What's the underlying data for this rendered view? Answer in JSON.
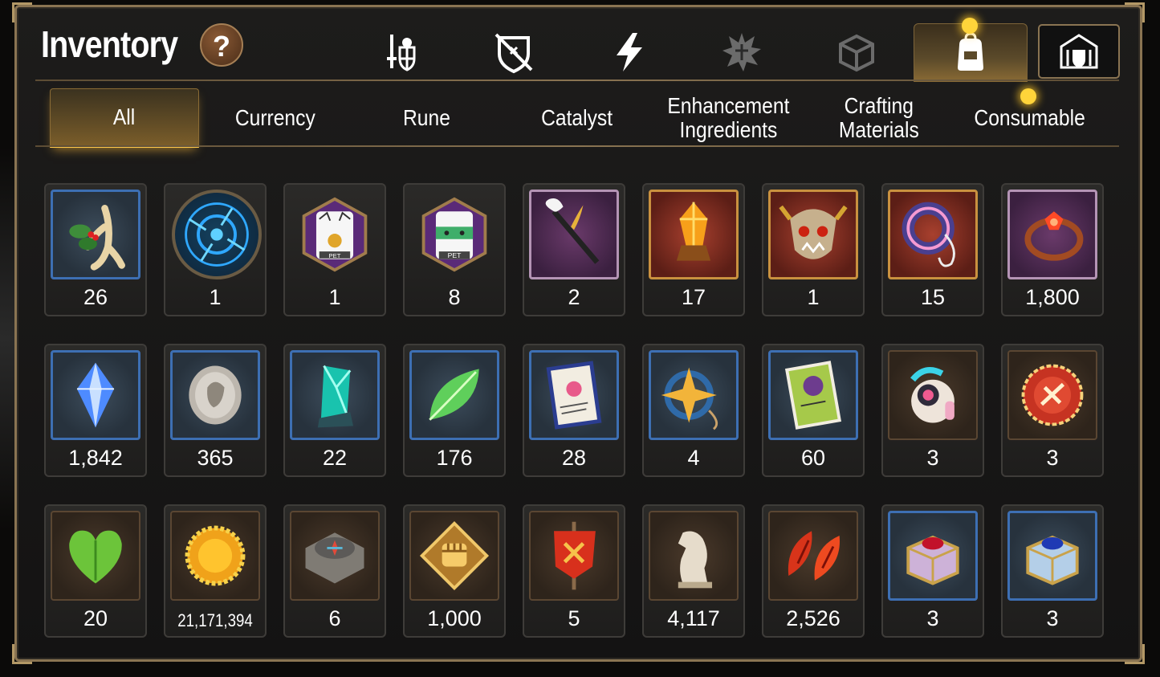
{
  "header": {
    "title": "Inventory",
    "help_label": "?"
  },
  "category_tabs": [
    {
      "icon": "sword-shield-icon",
      "active": false
    },
    {
      "icon": "broken-shield-icon",
      "active": false
    },
    {
      "icon": "lightning-icon",
      "active": false
    },
    {
      "icon": "burst-emblem-icon",
      "active": false
    },
    {
      "icon": "cube-icon",
      "active": false
    },
    {
      "icon": "backpack-icon",
      "active": true
    },
    {
      "icon": "castle-shield-icon",
      "active": false
    }
  ],
  "sub_tabs": [
    {
      "label": "All",
      "active": true
    },
    {
      "label": "Currency",
      "active": false
    },
    {
      "label": "Rune",
      "active": false
    },
    {
      "label": "Catalyst",
      "active": false
    },
    {
      "label": "Enhancement\nIngredients",
      "active": false
    },
    {
      "label": "Crafting\nMaterials",
      "active": false
    },
    {
      "label": "Consumable",
      "active": false
    }
  ],
  "items": [
    {
      "icon": "ginseng-root-icon",
      "frame": "blue",
      "qty": "26"
    },
    {
      "icon": "blue-rune-circle-icon",
      "frame": "round",
      "qty": "1"
    },
    {
      "icon": "pet-food-bag-medal-icon",
      "frame": "hex",
      "qty": "1"
    },
    {
      "icon": "pet-food-bag-icon",
      "frame": "hex",
      "qty": "8"
    },
    {
      "icon": "feather-wand-icon",
      "frame": "purple",
      "qty": "2"
    },
    {
      "icon": "fire-crystal-icon",
      "frame": "red",
      "qty": "17"
    },
    {
      "icon": "demon-mask-icon",
      "frame": "red",
      "qty": "1"
    },
    {
      "icon": "blue-ring-pendant-icon",
      "frame": "red",
      "qty": "15"
    },
    {
      "icon": "red-flower-ring-icon",
      "frame": "purple",
      "qty": "1,800"
    },
    {
      "icon": "blue-crystal-icon",
      "frame": "blue",
      "qty": "1,842"
    },
    {
      "icon": "silver-coin-icon",
      "frame": "blue",
      "qty": "365"
    },
    {
      "icon": "teal-crystal-icon",
      "frame": "blue",
      "qty": "22"
    },
    {
      "icon": "green-leaf-icon",
      "frame": "blue",
      "qty": "176"
    },
    {
      "icon": "paw-certificate-icon",
      "frame": "blue",
      "qty": "28"
    },
    {
      "icon": "star-amulet-icon",
      "frame": "blue",
      "qty": "4"
    },
    {
      "icon": "green-card-icon",
      "frame": "blue",
      "qty": "60"
    },
    {
      "icon": "cute-robot-icon",
      "frame": "brown",
      "qty": "3"
    },
    {
      "icon": "red-badge-icon",
      "frame": "brown",
      "qty": "3"
    },
    {
      "icon": "green-heart-icon",
      "frame": "brown",
      "qty": "20"
    },
    {
      "icon": "gold-coin-icon",
      "frame": "brown",
      "qty": "21,171,394"
    },
    {
      "icon": "stone-compass-icon",
      "frame": "brown",
      "qty": "6"
    },
    {
      "icon": "fist-emblem-icon",
      "frame": "brown",
      "qty": "1,000"
    },
    {
      "icon": "red-banner-icon",
      "frame": "brown",
      "qty": "5"
    },
    {
      "icon": "chess-knight-icon",
      "frame": "brown",
      "qty": "4,117"
    },
    {
      "icon": "autumn-leaves-icon",
      "frame": "brown",
      "qty": "2,526"
    },
    {
      "icon": "pink-jewel-box-icon",
      "frame": "blue",
      "qty": "3"
    },
    {
      "icon": "blue-jewel-box-icon",
      "frame": "blue",
      "qty": "3"
    }
  ],
  "colors": {
    "panel_border": "#8a7452",
    "active_tab_glow": "#ffc94a",
    "notification_dot": "#ffd43a",
    "rare_frame": "#3d6fb3"
  }
}
